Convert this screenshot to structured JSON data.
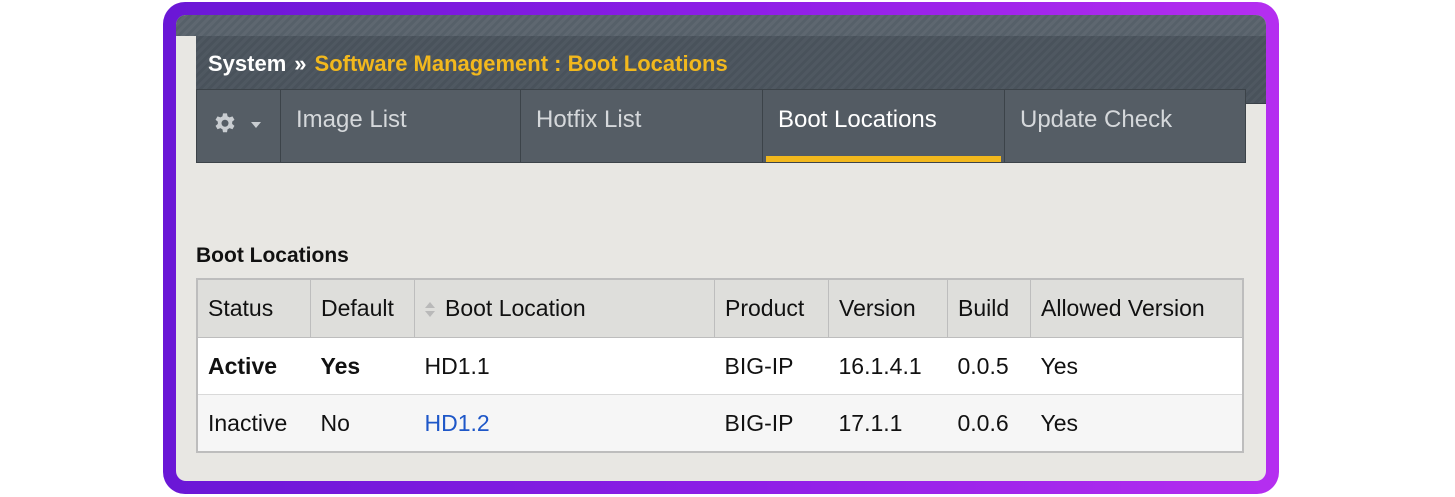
{
  "breadcrumb": {
    "root": "System",
    "separator": "»",
    "current": "Software Management : Boot Locations"
  },
  "tabs": [
    {
      "label": "Image List",
      "active": false
    },
    {
      "label": "Hotfix List",
      "active": false
    },
    {
      "label": "Boot Locations",
      "active": true
    },
    {
      "label": "Update Check",
      "active": false
    }
  ],
  "menu": {
    "icon": "gear-icon",
    "dropdown_icon": "chevron-down-icon"
  },
  "section": {
    "title": "Boot Locations"
  },
  "table": {
    "columns": [
      "Status",
      "Default",
      "Boot Location",
      "Product",
      "Version",
      "Build",
      "Allowed Version"
    ],
    "sort_icon": "sort-icon",
    "rows": [
      {
        "status": "Active",
        "default": "Yes",
        "boot_location": "HD1.1",
        "product": "BIG-IP",
        "version": "16.1.4.1",
        "build": "0.0.5",
        "allowed_version": "Yes"
      },
      {
        "status": "Inactive",
        "default": "No",
        "boot_location": "HD1.2",
        "product": "BIG-IP",
        "version": "17.1.1",
        "build": "0.0.6",
        "allowed_version": "Yes"
      }
    ]
  },
  "colors": {
    "accent": "#f2b81d",
    "frame_start": "#6a17d6",
    "frame_end": "#b52ef0",
    "header_bg": "#4f5861",
    "link": "#1e57c8"
  }
}
